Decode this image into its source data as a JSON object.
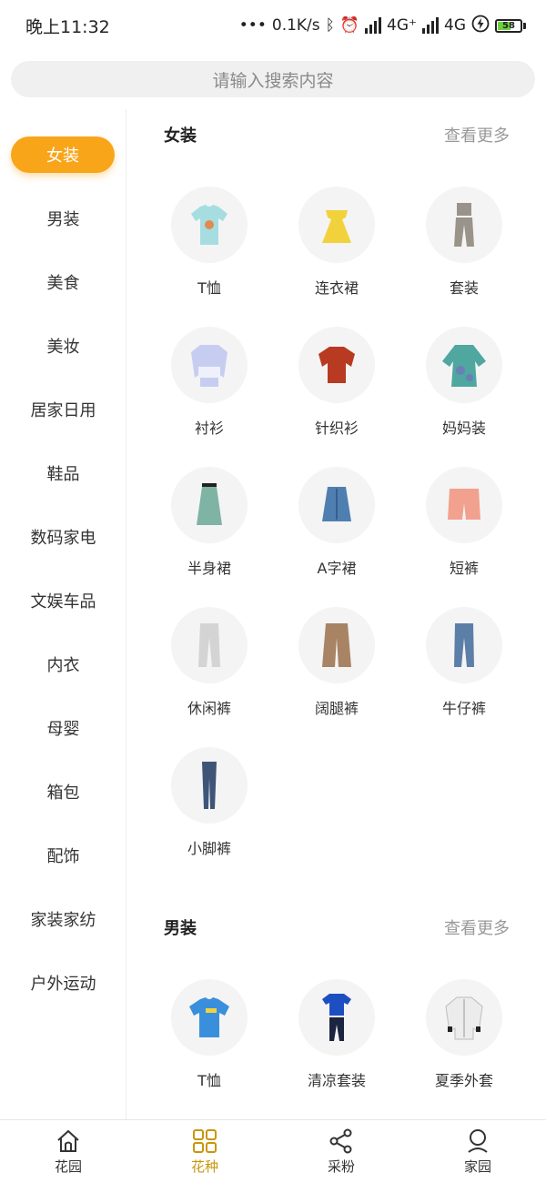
{
  "status_bar": {
    "time": "晚上11:32",
    "net_speed": "0.1K/s",
    "net1": "4G⁺",
    "net2": "4G",
    "battery": "58"
  },
  "search": {
    "placeholder": "请输入搜索内容"
  },
  "sidebar": {
    "items": [
      {
        "label": "女装"
      },
      {
        "label": "男装"
      },
      {
        "label": "美食"
      },
      {
        "label": "美妆"
      },
      {
        "label": "居家日用"
      },
      {
        "label": "鞋品"
      },
      {
        "label": "数码家电"
      },
      {
        "label": "文娱车品"
      },
      {
        "label": "内衣"
      },
      {
        "label": "母婴"
      },
      {
        "label": "箱包"
      },
      {
        "label": "配饰"
      },
      {
        "label": "家装家纺"
      },
      {
        "label": "户外运动"
      }
    ]
  },
  "sections": [
    {
      "title": "女装",
      "more": "查看更多",
      "items": [
        {
          "label": "T恤",
          "icon": "tshirt-icon"
        },
        {
          "label": "连衣裙",
          "icon": "dress-icon"
        },
        {
          "label": "套装",
          "icon": "suit-icon"
        },
        {
          "label": "衬衫",
          "icon": "shirt-icon"
        },
        {
          "label": "针织衫",
          "icon": "sweater-icon"
        },
        {
          "label": "妈妈装",
          "icon": "mom-wear-icon"
        },
        {
          "label": "半身裙",
          "icon": "skirt-icon"
        },
        {
          "label": "A字裙",
          "icon": "a-line-skirt-icon"
        },
        {
          "label": "短裤",
          "icon": "shorts-icon"
        },
        {
          "label": "休闲裤",
          "icon": "casual-pants-icon"
        },
        {
          "label": "阔腿裤",
          "icon": "wide-leg-pants-icon"
        },
        {
          "label": "牛仔裤",
          "icon": "jeans-icon"
        },
        {
          "label": "小脚裤",
          "icon": "skinny-pants-icon"
        }
      ]
    },
    {
      "title": "男装",
      "more": "查看更多",
      "items": [
        {
          "label": "T恤",
          "icon": "tshirt-icon"
        },
        {
          "label": "清凉套装",
          "icon": "summer-set-icon"
        },
        {
          "label": "夏季外套",
          "icon": "summer-jacket-icon"
        }
      ]
    }
  ],
  "bottom_nav": {
    "items": [
      {
        "label": "花园",
        "icon": "home-icon"
      },
      {
        "label": "花种",
        "icon": "grid-icon"
      },
      {
        "label": "采粉",
        "icon": "share-icon"
      },
      {
        "label": "家园",
        "icon": "profile-icon"
      }
    ],
    "active_color": "#c9960c"
  },
  "colors": {
    "accent": "#f9a51a",
    "search_bg": "#f0f0f0"
  }
}
